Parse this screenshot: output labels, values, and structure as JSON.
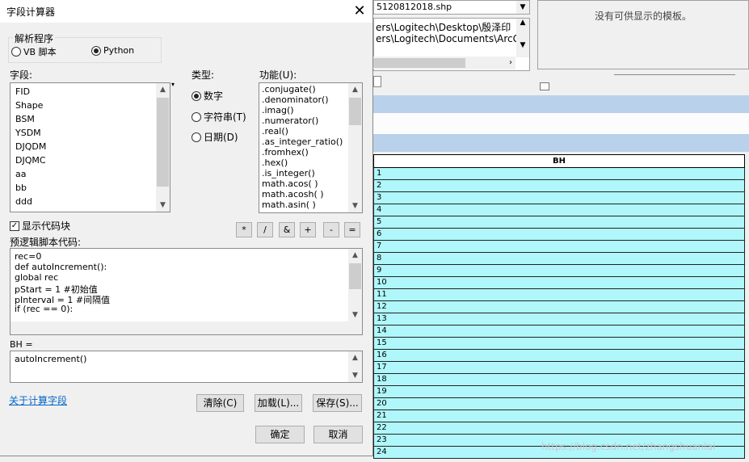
{
  "background": {
    "layer_combo": "5120812018.shp",
    "path_lines": [
      "ers\\Logitech\\Desktop\\殷泽印",
      "ers\\Logitech\\Documents\\ArcGI"
    ],
    "template_message": "没有可供显示的模板。",
    "table_header": "BH",
    "table_rows": [
      "1",
      "2",
      "3",
      "4",
      "5",
      "6",
      "7",
      "8",
      "9",
      "10",
      "11",
      "12",
      "13",
      "14",
      "15",
      "16",
      "17",
      "18",
      "19",
      "20",
      "21",
      "22",
      "23",
      "24"
    ],
    "watermark": "https://blog.csdn.net/zhangshuanlai"
  },
  "dialog": {
    "title": "字段计算器",
    "parser": {
      "label": "解析程序",
      "options": [
        {
          "label": "VB 脚本",
          "selected": false
        },
        {
          "label": "Python",
          "selected": true
        }
      ]
    },
    "fields": {
      "label": "字段:",
      "items": [
        "FID",
        "Shape",
        "BSM",
        "YSDM",
        "DJQDM",
        "DJQMC",
        "aa",
        "bb",
        "ddd"
      ]
    },
    "type": {
      "label": "类型:",
      "options": [
        {
          "label": "数字",
          "selected": true
        },
        {
          "label": "字符串(T)",
          "selected": false
        },
        {
          "label": "日期(D)",
          "selected": false
        }
      ]
    },
    "functions": {
      "label": "功能(U):",
      "items": [
        ".conjugate()",
        ".denominator()",
        ".imag()",
        ".numerator()",
        ".real()",
        ".as_integer_ratio()",
        ".fromhex()",
        ".hex()",
        ".is_integer()",
        "math.acos( )",
        "math.acosh( )",
        "math.asin( )"
      ]
    },
    "show_codeblock": {
      "label": "显示代码块",
      "checked": true
    },
    "operators": [
      "*",
      "/",
      "&",
      "+",
      "-",
      "="
    ],
    "pre_logic": {
      "label": "预逻辑脚本代码:",
      "lines": [
        "rec=0",
        "def autoIncrement():",
        " global rec",
        " pStart = 1 #初始值",
        " pInterval = 1 #间隔值",
        " if (rec == 0):"
      ]
    },
    "expression": {
      "label": "BH =",
      "value": "autoIncrement()"
    },
    "about_link": "关于计算字段",
    "buttons": {
      "clear": "清除(C)",
      "load": "加载(L)...",
      "save": "保存(S)...",
      "ok": "确定",
      "cancel": "取消"
    },
    "close_glyph": "✕"
  }
}
